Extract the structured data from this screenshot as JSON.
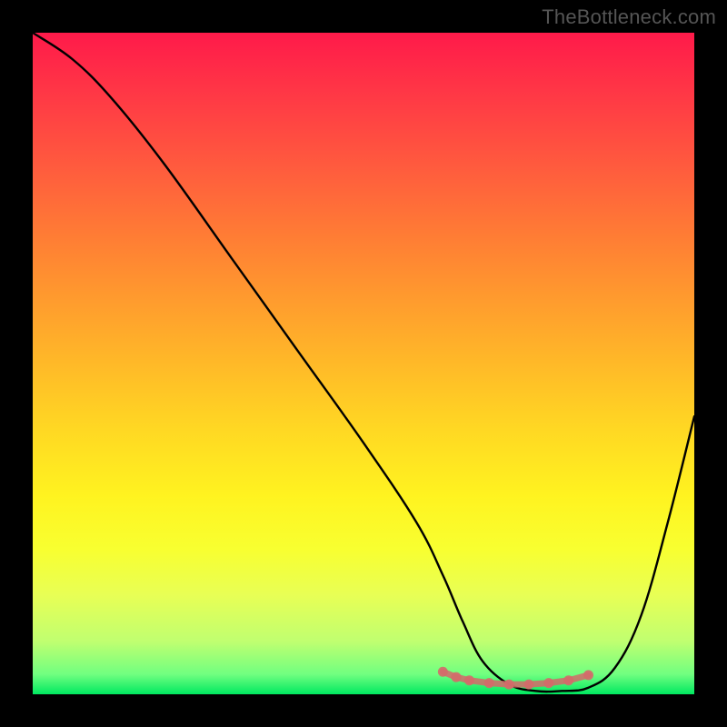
{
  "watermark": "TheBottleneck.com",
  "chart_data": {
    "type": "line",
    "title": "",
    "xlabel": "",
    "ylabel": "",
    "xlim": [
      0,
      100
    ],
    "ylim": [
      0,
      100
    ],
    "series": [
      {
        "name": "bottleneck-curve",
        "x": [
          0,
          6,
          12,
          20,
          30,
          40,
          50,
          58,
          62,
          65,
          68,
          72,
          76,
          80,
          84,
          88,
          92,
          96,
          100
        ],
        "y": [
          100,
          96,
          90,
          80,
          66,
          52,
          38,
          26,
          18,
          11,
          5,
          1.5,
          0.5,
          0.5,
          1,
          4,
          12,
          26,
          42
        ]
      },
      {
        "name": "bottom-markers",
        "x": [
          62,
          64,
          66,
          69,
          72,
          75,
          78,
          81,
          84
        ],
        "y": [
          3.4,
          2.6,
          2.1,
          1.7,
          1.5,
          1.5,
          1.7,
          2.1,
          2.9
        ]
      }
    ],
    "colors": {
      "curve": "#000000",
      "markers": "#d46a6a"
    }
  }
}
